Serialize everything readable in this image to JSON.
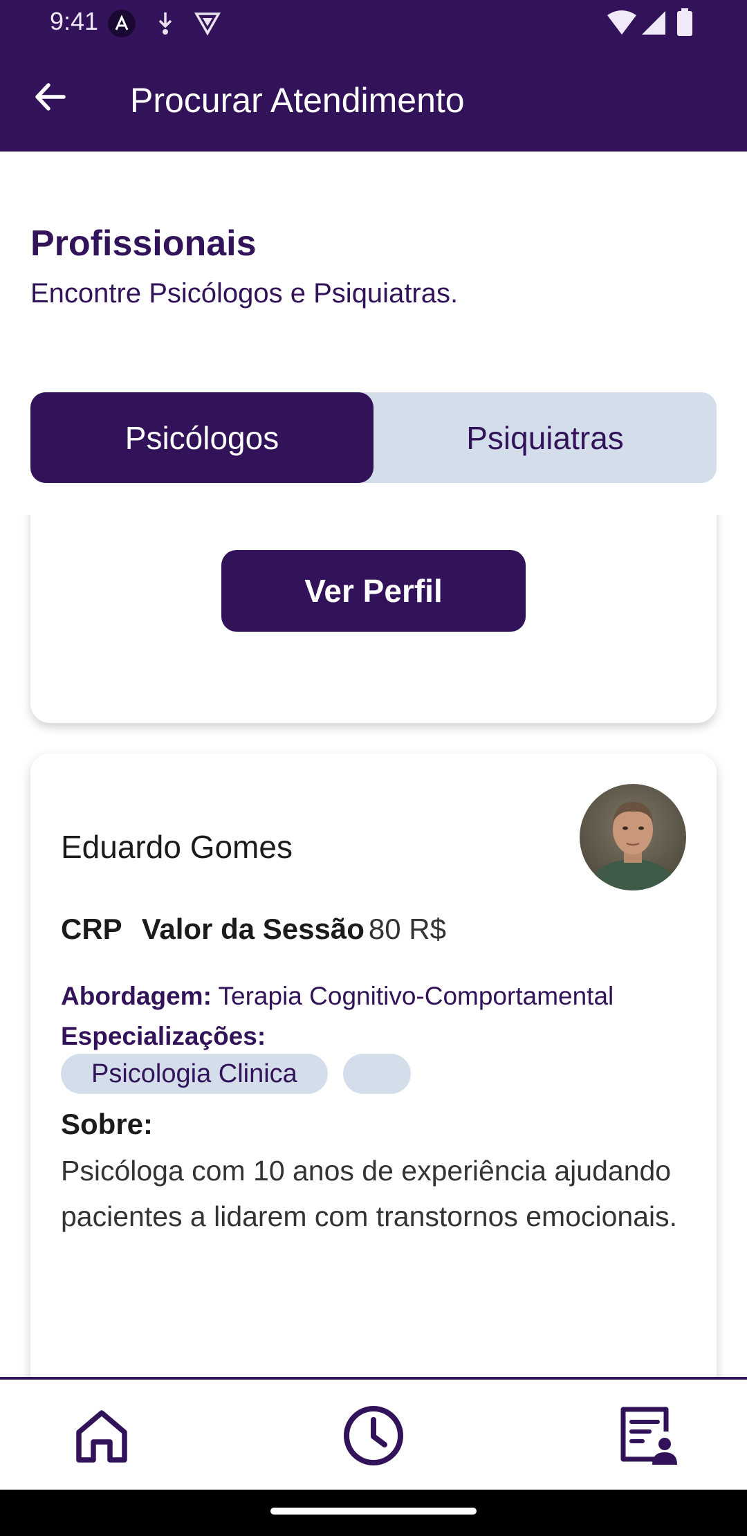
{
  "status_bar": {
    "time": "9:41"
  },
  "app_bar": {
    "title": "Procurar Atendimento",
    "back_icon": "arrow-left-icon"
  },
  "header": {
    "title": "Profissionais",
    "subtitle": "Encontre Psicólogos e Psiquiatras."
  },
  "tabs": [
    {
      "label": "Psicólogos",
      "active": true
    },
    {
      "label": "Psiquiatras",
      "active": false
    }
  ],
  "previous_card": {
    "button_label": "Ver Perfil"
  },
  "professional": {
    "name": "Eduardo Gomes",
    "crp_label": "CRP",
    "price_label": "Valor da Sessão",
    "price_value": "80 R$",
    "approach_label": "Abordagem:",
    "approach_value": "Terapia Cognitivo-Comportamental",
    "specializations_label": "Especializações:",
    "specializations": [
      "Psicologia Clinica",
      ""
    ],
    "about_label": "Sobre:",
    "about_text": "Psicóloga com 10 anos de experiência ajudando pacientes a lidarem com transtornos emocionais."
  },
  "bottom_nav": [
    {
      "icon": "home-icon"
    },
    {
      "icon": "clock-icon"
    },
    {
      "icon": "profile-document-icon"
    }
  ],
  "colors": {
    "primary": "#32135a",
    "secondary": "#d3deea"
  }
}
